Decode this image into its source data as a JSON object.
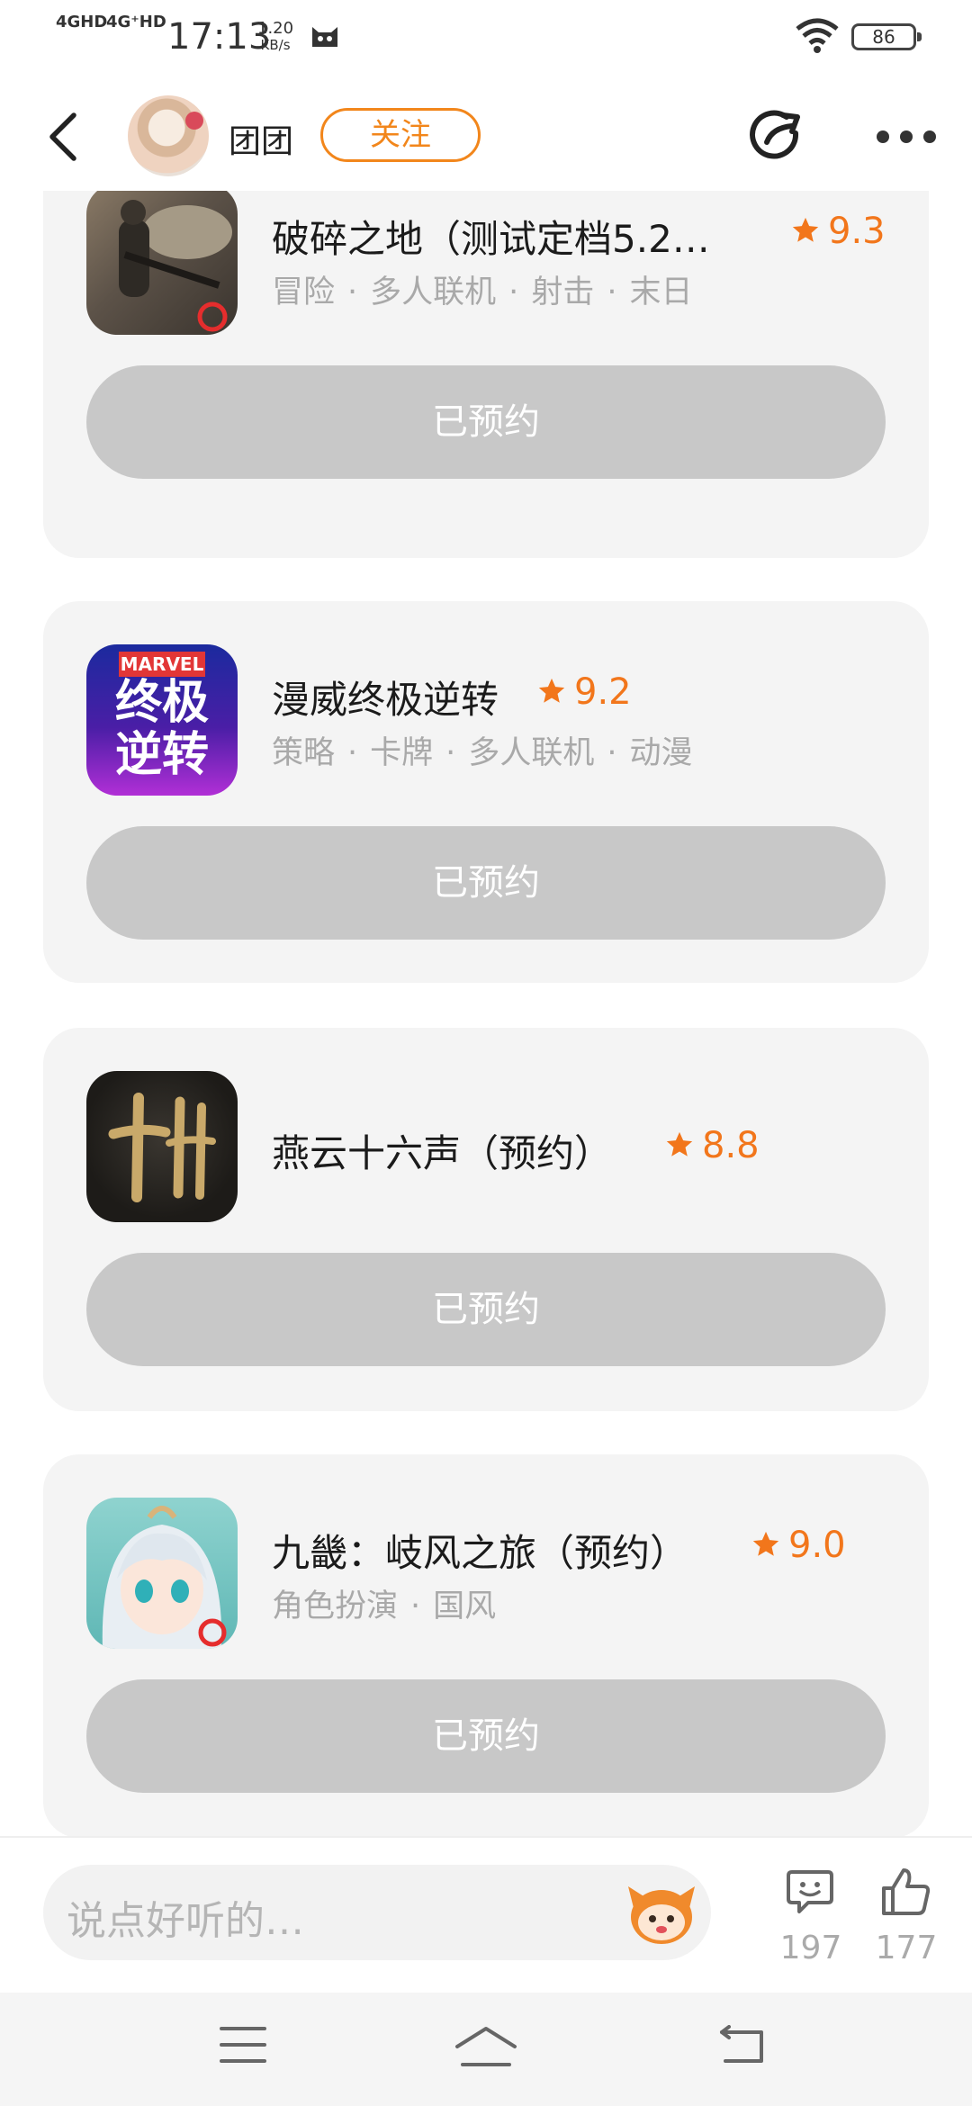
{
  "status_bar": {
    "signal1": "4GHD",
    "signal2": "4G⁺HD",
    "time": "17:13",
    "speed_value": "1.20",
    "speed_unit": "KB/s",
    "battery": "86"
  },
  "header": {
    "username": "团团",
    "follow_label": "关注"
  },
  "games": [
    {
      "title": "破碎之地（测试定档5.2…",
      "rating": "9.3",
      "tags": [
        "冒险",
        "多人联机",
        "射击",
        "末日"
      ],
      "button": "已预约"
    },
    {
      "title": "漫威终极逆转",
      "rating": "9.2",
      "tags": [
        "策略",
        "卡牌",
        "多人联机",
        "动漫"
      ],
      "icon_text_top": "MARVEL",
      "icon_text_mid": "终极",
      "icon_text_bottom": "逆转",
      "button": "已预约"
    },
    {
      "title": "燕云十六声（预约）",
      "rating": "8.8",
      "tags": [],
      "button": "已预约"
    },
    {
      "title": "九畿：岐风之旅（预约）",
      "rating": "9.0",
      "tags": [
        "角色扮演",
        "国风"
      ],
      "button": "已预约"
    }
  ],
  "comment_bar": {
    "placeholder": "说点好听的…",
    "reply_count": "197",
    "like_count": "177"
  },
  "colors": {
    "accent": "#f2761b",
    "button_disabled": "#c8c8c8",
    "card_bg": "#f4f4f4"
  }
}
